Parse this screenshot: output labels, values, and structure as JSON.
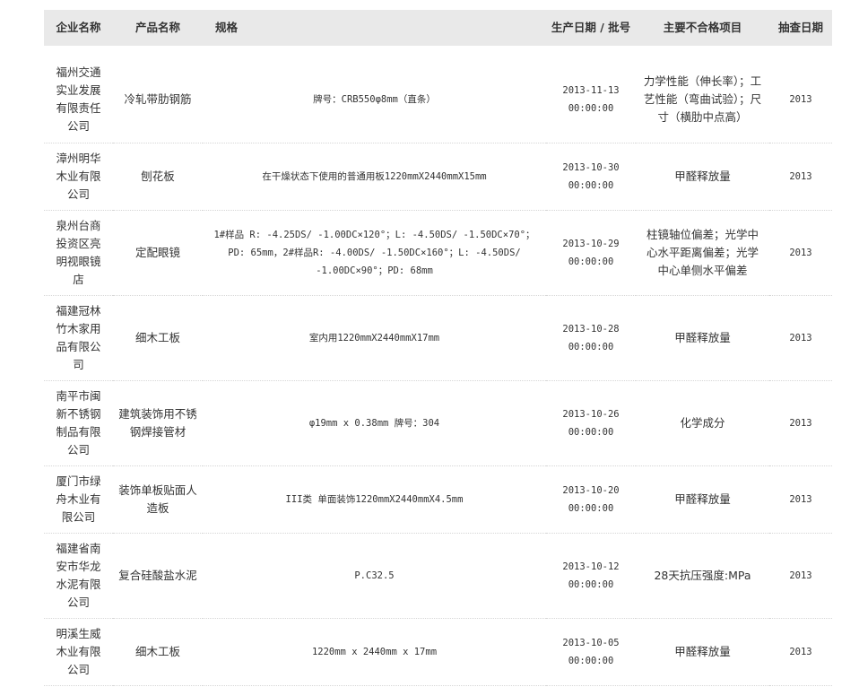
{
  "headers": {
    "company": "企业名称",
    "product": "产品名称",
    "spec": "规格",
    "date": "生产日期 / 批号",
    "issue": "主要不合格项目",
    "year": "抽查日期"
  },
  "rows": [
    {
      "company": "福州交通实业发展有限责任公司",
      "product": "冷轧带肋钢筋",
      "spec": "牌号：CRB550φ8mm（直条）",
      "date": "2013-11-13",
      "time": "00:00:00",
      "issue": "力学性能（伸长率）；工艺性能（弯曲试验）；尺寸（横肋中点高）",
      "year": "2013"
    },
    {
      "company": "漳州明华木业有限公司",
      "product": "刨花板",
      "spec": "在干燥状态下使用的普通用板1220mmX2440mmX15mm",
      "date": "2013-10-30",
      "time": "00:00:00",
      "issue": "甲醛释放量",
      "year": "2013"
    },
    {
      "company": "泉州台商投资区亮明视眼镜店",
      "product": "定配眼镜",
      "spec": "1#样品 R: -4.25DS/ -1.00DC×120°；L: -4.50DS/ -1.50DC×70°；PD: 65mm，2#样品R: -4.00DS/ -1.50DC×160°；L: -4.50DS/ -1.00DC×90°；PD: 68mm",
      "date": "2013-10-29",
      "time": "00:00:00",
      "issue": "柱镜轴位偏差；光学中心水平距离偏差；光学中心单侧水平偏差",
      "year": "2013"
    },
    {
      "company": "福建冠林竹木家用品有限公司",
      "product": "细木工板",
      "spec": "室内用1220mmX2440mmX17mm",
      "date": "2013-10-28",
      "time": "00:00:00",
      "issue": "甲醛释放量",
      "year": "2013"
    },
    {
      "company": "南平市闽新不锈钢制品有限公司",
      "product": "建筑装饰用不锈钢焊接管材",
      "spec": "φ19mm x 0.38mm 牌号：304",
      "date": "2013-10-26",
      "time": "00:00:00",
      "issue": "化学成分",
      "year": "2013"
    },
    {
      "company": "厦门市绿舟木业有限公司",
      "product": "装饰单板贴面人造板",
      "spec": "III类 单面装饰1220mmX2440mmX4.5mm",
      "date": "2013-10-20",
      "time": "00:00:00",
      "issue": "甲醛释放量",
      "year": "2013"
    },
    {
      "company": "福建省南安市华龙水泥有限公司",
      "product": "复合硅酸盐水泥",
      "spec": "P.C32.5",
      "date": "2013-10-12",
      "time": "00:00:00",
      "issue": "28天抗压强度:MPa",
      "year": "2013"
    },
    {
      "company": "明溪生威木业有限公司",
      "product": "细木工板",
      "spec": "1220mm x 2440mm x 17mm",
      "date": "2013-10-05",
      "time": "00:00:00",
      "issue": "甲醛释放量",
      "year": "2013"
    }
  ]
}
